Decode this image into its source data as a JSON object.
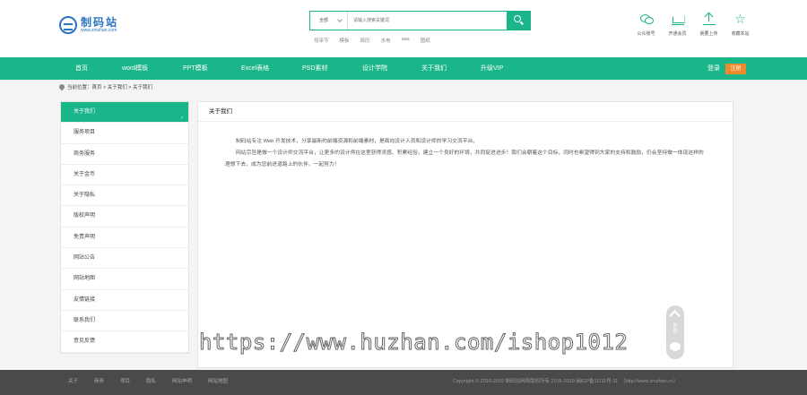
{
  "logo": {
    "name": "制码站",
    "url": "www.zmzhan.com"
  },
  "search": {
    "category": "全部",
    "placeholder": "请输入搜索关键词",
    "button_icon": "search-icon"
  },
  "hotwords": [
    "母亲节",
    "模板",
    "简历",
    "水电",
    "aaa",
    "图纸"
  ],
  "tools": [
    {
      "label": "公众账号",
      "icon": "wechat-icon"
    },
    {
      "label": "开通会员",
      "icon": "crown-icon"
    },
    {
      "label": "我要上传",
      "icon": "upload-icon"
    },
    {
      "label": "收藏本站",
      "icon": "star-icon"
    }
  ],
  "nav": {
    "items": [
      "首页",
      "word模板",
      "PPT模板",
      "Excel表格",
      "PSD素材",
      "设计学院",
      "关于我们",
      "升级VIP"
    ],
    "login": "登录",
    "register": "注册"
  },
  "breadcrumb": "当前位置：首页 > 关于我们 > 关于我们",
  "sidebar": {
    "items": [
      "关于我们",
      "服务项目",
      "商务服务",
      "关于金币",
      "关于隐私",
      "版权声明",
      "免责声明",
      "网站公告",
      "网站地图",
      "友情链接",
      "联系我们",
      "意见反馈"
    ],
    "active_arrow": "›"
  },
  "main": {
    "title": "关于我们",
    "paragraphs": [
      "制码站专注 Web 开发技术，分享最新的前端资源和前端素材，是面向设计人员和设计师的学习交流平台。",
      "网站宗旨是做一个设计师交流平台，让更多的设计师在这里获得灵感、积累经验，建立一个良好的环境，共同促进进步！我们会朝着这个目标，同时也希望得到大家的支持和鼓励，仍会坚持做一体现这样的理想下去，成为您前进道路上的伙伴，一起努力！"
    ]
  },
  "float_widget": {
    "text": "反馈"
  },
  "watermark": "https://www.huzhan.com/ishop1012",
  "footer": {
    "links": [
      "关于",
      "商务",
      "项目",
      "隐私",
      "网站申明",
      "网站地图"
    ],
    "copyright": "Copyright © 2016-2019 制码站网络版权所有 2016-2019 闽ICP备11111号-11　（http://www.zmzhan.cn）"
  }
}
